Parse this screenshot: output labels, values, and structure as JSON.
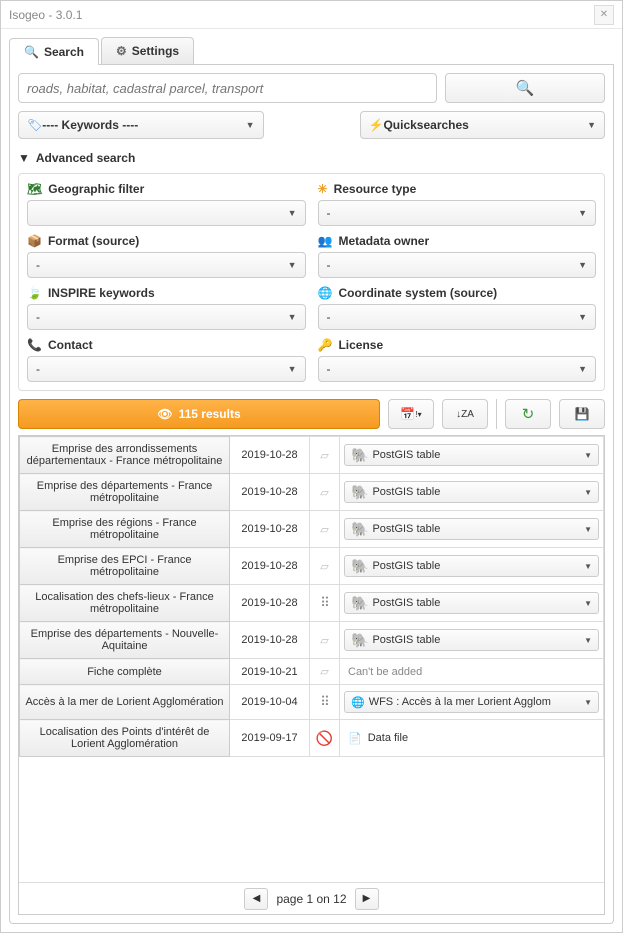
{
  "window": {
    "title": "Isogeo - 3.0.1"
  },
  "tabs": {
    "search": "Search",
    "settings": "Settings"
  },
  "search": {
    "placeholder": "roads, habitat, cadastral parcel, transport"
  },
  "keywords": {
    "label": "---- Keywords ----"
  },
  "quicksearches": {
    "label": "Quicksearches"
  },
  "advanced": {
    "label": "Advanced search"
  },
  "filters": {
    "geo": {
      "label": "Geographic filter",
      "value": ""
    },
    "restype": {
      "label": "Resource type",
      "value": "-"
    },
    "format": {
      "label": "Format (source)",
      "value": "-"
    },
    "owner": {
      "label": "Metadata owner",
      "value": "-"
    },
    "inspire": {
      "label": "INSPIRE keywords",
      "value": "-"
    },
    "coord": {
      "label": "Coordinate system (source)",
      "value": "-"
    },
    "contact": {
      "label": "Contact",
      "value": "-"
    },
    "license": {
      "label": "License",
      "value": "-"
    }
  },
  "results": {
    "count": "115 results"
  },
  "table_rows": [
    {
      "name": "Emprise des arrondissements départementaux - France métropolitaine",
      "date": "2019-10-28",
      "geom": "poly",
      "layer_type": "postgis",
      "layer_label": "PostGIS table"
    },
    {
      "name": "Emprise des départements - France métropolitaine",
      "date": "2019-10-28",
      "geom": "poly",
      "layer_type": "postgis",
      "layer_label": "PostGIS table"
    },
    {
      "name": "Emprise des régions - France métropolitaine",
      "date": "2019-10-28",
      "geom": "poly",
      "layer_type": "postgis",
      "layer_label": "PostGIS table"
    },
    {
      "name": "Emprise des EPCI - France métropolitaine",
      "date": "2019-10-28",
      "geom": "poly",
      "layer_type": "postgis",
      "layer_label": "PostGIS table"
    },
    {
      "name": "Localisation des chefs-lieux - France métropolitaine",
      "date": "2019-10-28",
      "geom": "point",
      "layer_type": "postgis",
      "layer_label": "PostGIS table"
    },
    {
      "name": "Emprise des départements - Nouvelle-Aquitaine",
      "date": "2019-10-28",
      "geom": "poly",
      "layer_type": "postgis",
      "layer_label": "PostGIS table"
    },
    {
      "name": "Fiche complète",
      "date": "2019-10-21",
      "geom": "poly",
      "layer_type": "none",
      "layer_label": "Can't be added"
    },
    {
      "name": "Accès à la mer de Lorient Agglomération",
      "date": "2019-10-04",
      "geom": "point",
      "layer_type": "wfs",
      "layer_label": "WFS : Accès à la mer Lorient Agglom"
    },
    {
      "name": "Localisation des Points d'intérêt de Lorient Agglomération",
      "date": "2019-09-17",
      "geom": "blocked",
      "layer_type": "file",
      "layer_label": "Data file"
    }
  ],
  "pager": {
    "text": "page 1 on 12"
  }
}
